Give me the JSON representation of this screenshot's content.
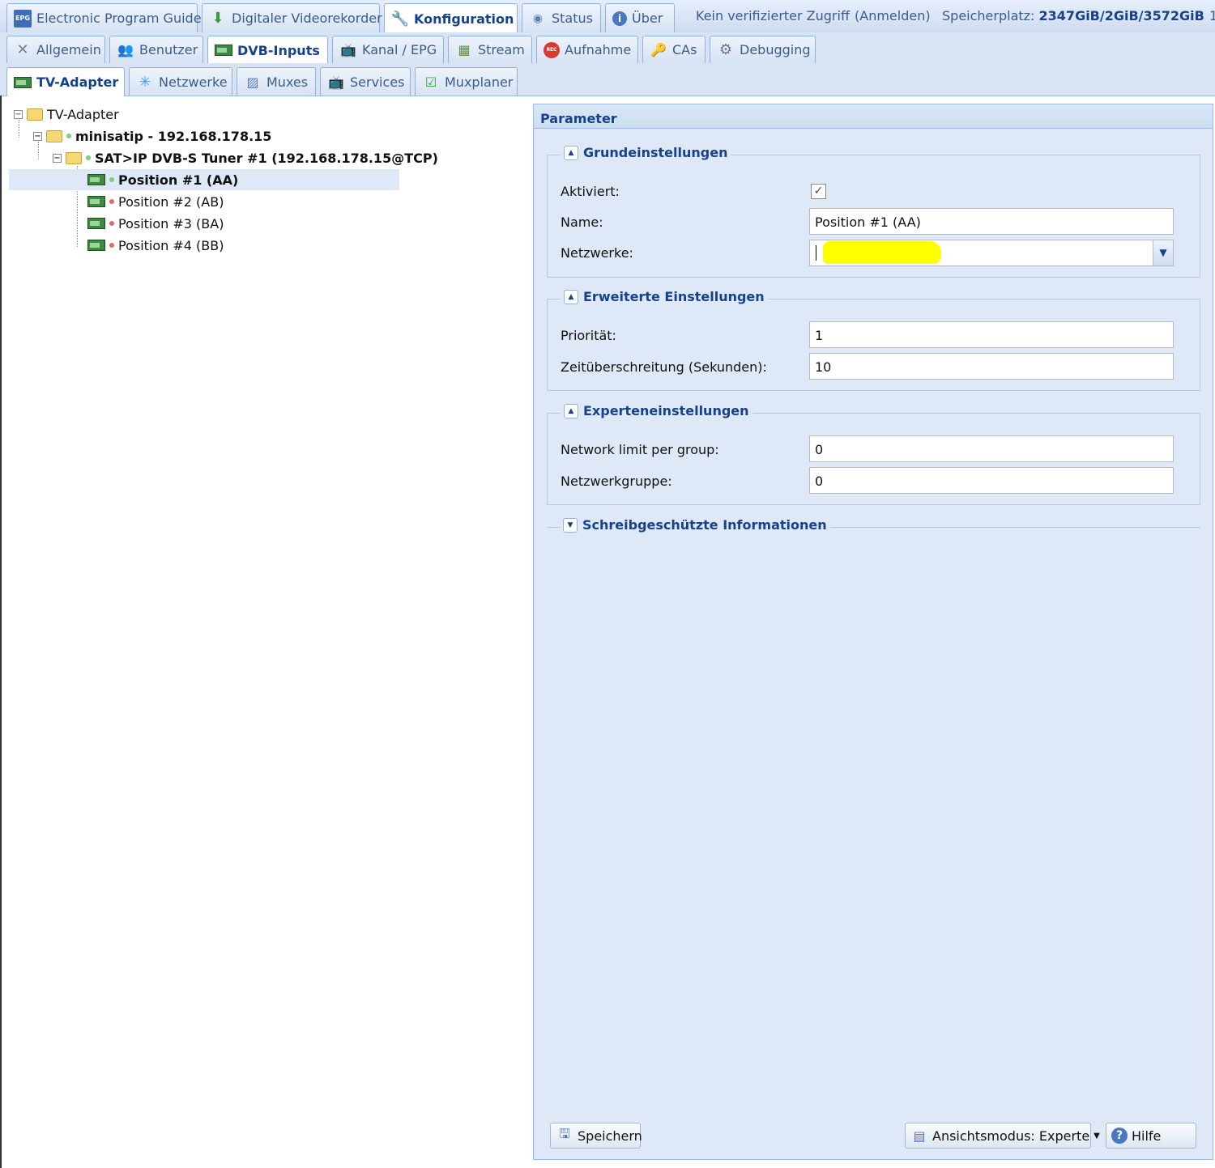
{
  "top_tabs": [
    {
      "label": "Electronic Program Guide",
      "icon": "epg-icon"
    },
    {
      "label": "Digitaler Videorekorder",
      "icon": "download-icon"
    },
    {
      "label": "Konfiguration",
      "icon": "wrench-icon"
    },
    {
      "label": "Status",
      "icon": "eye-icon"
    },
    {
      "label": "Über",
      "icon": "info-icon"
    }
  ],
  "header": {
    "access_text": "Kein verifizierter Zugriff",
    "login_link": "(Anmelden)",
    "storage_label": "Speicherplatz:",
    "storage_value": "2347GiB/2GiB/3572GiB",
    "overflow_text": "1"
  },
  "config_tabs": [
    {
      "label": "Allgemein",
      "icon": "tools-icon"
    },
    {
      "label": "Benutzer",
      "icon": "users-icon"
    },
    {
      "label": "DVB-Inputs",
      "icon": "tv-card-icon"
    },
    {
      "label": "Kanal / EPG",
      "icon": "tv-icon"
    },
    {
      "label": "Stream",
      "icon": "stream-icon"
    },
    {
      "label": "Aufnahme",
      "icon": "rec-icon"
    },
    {
      "label": "CAs",
      "icon": "key-icon"
    },
    {
      "label": "Debugging",
      "icon": "gears-icon"
    }
  ],
  "dvb_tabs": [
    {
      "label": "TV-Adapter",
      "icon": "tv-card-icon"
    },
    {
      "label": "Netzwerke",
      "icon": "antenna-icon"
    },
    {
      "label": "Muxes",
      "icon": "satellite-icon"
    },
    {
      "label": "Services",
      "icon": "tv-icon"
    },
    {
      "label": "Muxplaner",
      "icon": "calendar-check-icon"
    }
  ],
  "tree": {
    "root": "TV-Adapter",
    "device": "minisatip - 192.168.178.15",
    "tuner": "SAT>IP DVB-S Tuner #1 (192.168.178.15@TCP)",
    "positions": [
      "Position #1 (AA)",
      "Position #2 (AB)",
      "Position #3 (BA)",
      "Position #4 (BB)"
    ]
  },
  "panel": {
    "title": "Parameter",
    "basic": {
      "legend": "Grundeinstellungen",
      "enabled_label": "Aktiviert:",
      "enabled": true,
      "name_label": "Name:",
      "name_value": "Position #1 (AA)",
      "networks_label": "Netzwerke:"
    },
    "advanced": {
      "legend": "Erweiterte Einstellungen",
      "priority_label": "Priorität:",
      "priority_value": "1",
      "timeout_label": "Zeitüberschreitung (Sekunden):",
      "timeout_value": "10"
    },
    "expert": {
      "legend": "Experteneinstellungen",
      "limit_label": "Network limit per group:",
      "limit_value": "0",
      "group_label": "Netzwerkgruppe:",
      "group_value": "0"
    },
    "readonly": {
      "legend": "Schreibgeschützte Informationen"
    },
    "buttons": {
      "save": "Speichern",
      "view_mode": "Ansichtsmodus: Experte",
      "help": "Hilfe"
    }
  },
  "colors": {
    "accent": "#15428b",
    "tab_text": "#3a5c8c",
    "panel_bg": "#dfe8f6",
    "highlight": "#ffff00"
  }
}
